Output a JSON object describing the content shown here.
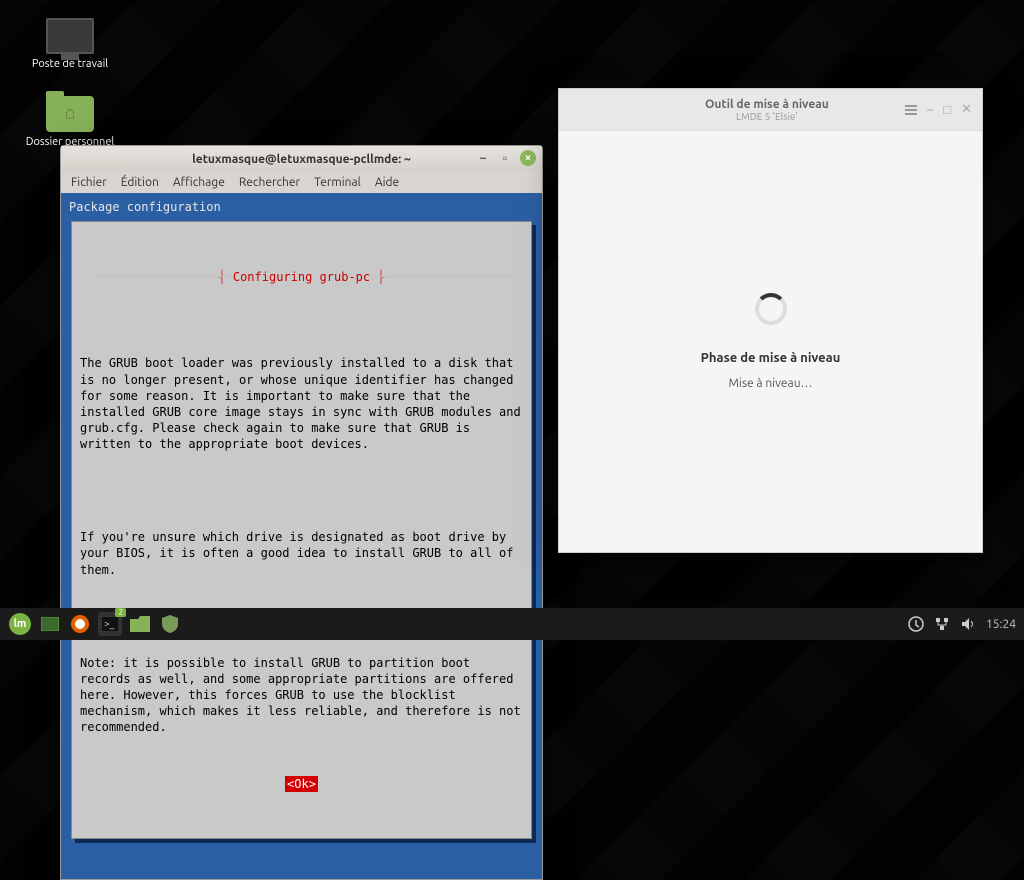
{
  "desktop": {
    "icons": [
      {
        "label": "Poste de travail"
      },
      {
        "label": "Dossier personnel"
      }
    ]
  },
  "terminal": {
    "title": "letuxmasque@letuxmasque-pcllmde: ~",
    "menu": [
      "Fichier",
      "Édition",
      "Affichage",
      "Rechercher",
      "Terminal",
      "Aide"
    ],
    "pkg_header": "Package configuration",
    "dialog_title": "Configuring grub-pc",
    "body_p1": "The GRUB boot loader was previously installed to a disk that is no longer present, or whose unique identifier has changed for some reason. It is important to make sure that the installed GRUB core image stays in sync with GRUB modules and grub.cfg. Please check again to make sure that GRUB is written to the appropriate boot devices.",
    "body_p2": "If you're unsure which drive is designated as boot drive by your BIOS, it is often a good idea to install GRUB to all of them.",
    "body_p3": "Note: it is possible to install GRUB to partition boot records as well, and some appropriate partitions are offered here. However, this forces GRUB to use the blocklist mechanism, which makes it less reliable, and therefore is not recommended.",
    "ok_label": "<Ok>"
  },
  "upgrade": {
    "title": "Outil de mise à niveau",
    "subtitle": "LMDE 5 'Elsie'",
    "phase": "Phase de mise à niveau",
    "status": "Mise à niveau…"
  },
  "taskbar": {
    "time": "15:24",
    "terminal_badge": "2"
  }
}
